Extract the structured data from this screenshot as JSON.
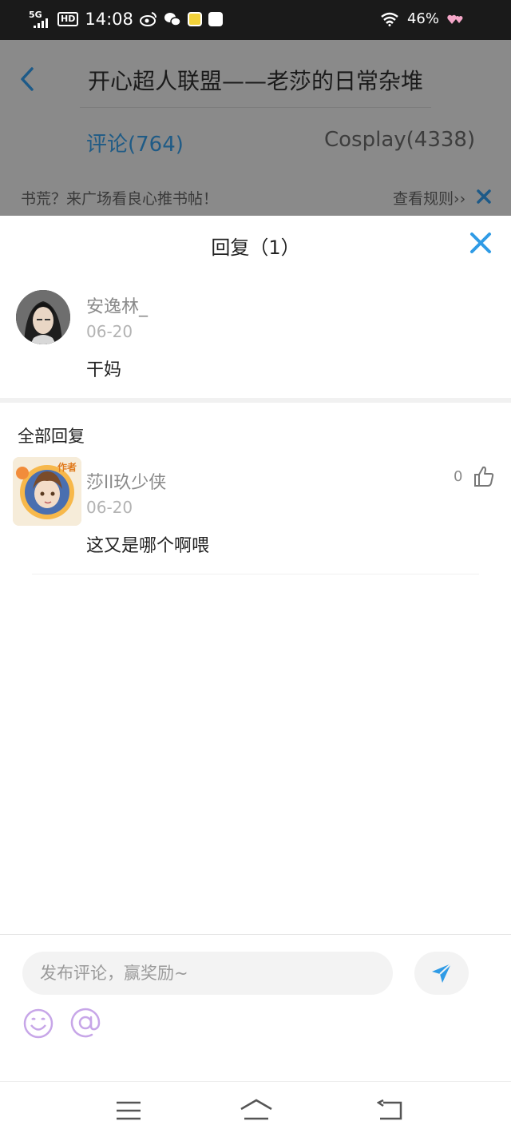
{
  "status_bar": {
    "network": "5G",
    "hd": "HD",
    "time": "14:08",
    "battery": "46%"
  },
  "header": {
    "title": "开心超人联盟——老莎的日常杂堆",
    "tabs": [
      {
        "label": "评论(764)",
        "active": true
      },
      {
        "label": "Cosplay(4338)",
        "active": false
      }
    ]
  },
  "notice": {
    "text": "书荒？来广场看良心推书帖！",
    "rules_link": "查看规则››"
  },
  "sheet": {
    "title": "回复（1）",
    "original_comment": {
      "author": "安逸林_",
      "date": "06-20",
      "content": "干妈"
    },
    "section_title": "全部回复",
    "replies": [
      {
        "author": "莎ll玖少侠",
        "date": "06-20",
        "content": "这又是哪个啊喂",
        "likes": "0",
        "badge": "作者"
      }
    ]
  },
  "composer": {
    "placeholder": "发布评论，赢奖励~"
  },
  "colors": {
    "accent_blue": "#2f9be6",
    "active_tab": "#1f5b86",
    "emoji_purple": "#c7a6e8"
  },
  "icons": [
    "back-arrow-icon",
    "close-icon",
    "thumbs-up-icon",
    "send-icon",
    "emoji-icon",
    "at-icon",
    "menu-icon",
    "home-icon",
    "back-icon"
  ]
}
